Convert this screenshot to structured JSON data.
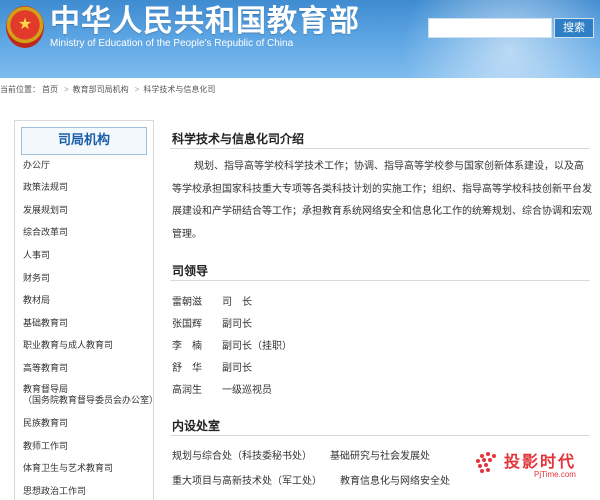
{
  "header": {
    "title_cn": "中华人民共和国教育部",
    "title_en": "Ministry of Education of the People's Republic of China",
    "search_button_label": "搜索"
  },
  "breadcrumb": {
    "prefix": "当前位置：",
    "items": [
      "首页",
      "教育部司局机构",
      "科学技术与信息化司"
    ]
  },
  "sidebar": {
    "title": "司局机构",
    "items": [
      {
        "label": "办公厅"
      },
      {
        "label": "政策法规司"
      },
      {
        "label": "发展规划司"
      },
      {
        "label": "综合改革司"
      },
      {
        "label": "人事司"
      },
      {
        "label": "财务司"
      },
      {
        "label": "教材局"
      },
      {
        "label": "基础教育司"
      },
      {
        "label": "职业教育与成人教育司"
      },
      {
        "label": "高等教育司"
      },
      {
        "label": "教育督导局",
        "sub": "（国务院教育督导委员会办公室）"
      },
      {
        "label": "民族教育司"
      },
      {
        "label": "教师工作司"
      },
      {
        "label": "体育卫生与艺术教育司"
      },
      {
        "label": "思想政治工作司"
      }
    ]
  },
  "main": {
    "intro_title": "科学技术与信息化司介绍",
    "intro_text": "规划、指导高等学校科学技术工作；协调、指导高等学校参与国家创新体系建设，以及高等学校承担国家科技重大专项等各类科技计划的实施工作；组织、指导高等学校科技创新平台发展建设和产学研结合等工作；承担教育系统网络安全和信息化工作的统筹规划、综合协调和宏观管理。",
    "leaders_title": "司领导",
    "leaders": [
      {
        "name": "雷朝滋",
        "role": "司　长"
      },
      {
        "name": "张国辉",
        "role": "副司长"
      },
      {
        "name": "李　楠",
        "role": "副司长（挂职）"
      },
      {
        "name": "舒　华",
        "role": "副司长"
      },
      {
        "name": "高润生",
        "role": "一级巡视员"
      }
    ],
    "depts_title": "内设处室",
    "depts": [
      "规划与综合处（科技委秘书处）",
      "基础研究与社会发展处",
      "重大项目与高新技术处（军工处）",
      "教育信息化与网络安全处"
    ]
  },
  "watermark": {
    "text": "投影时代",
    "url": "PjTime.com"
  },
  "colors": {
    "header_blue": "#3f8bd0",
    "sidebar_title": "#1b5ea8",
    "watermark_red": "#e2343b"
  }
}
